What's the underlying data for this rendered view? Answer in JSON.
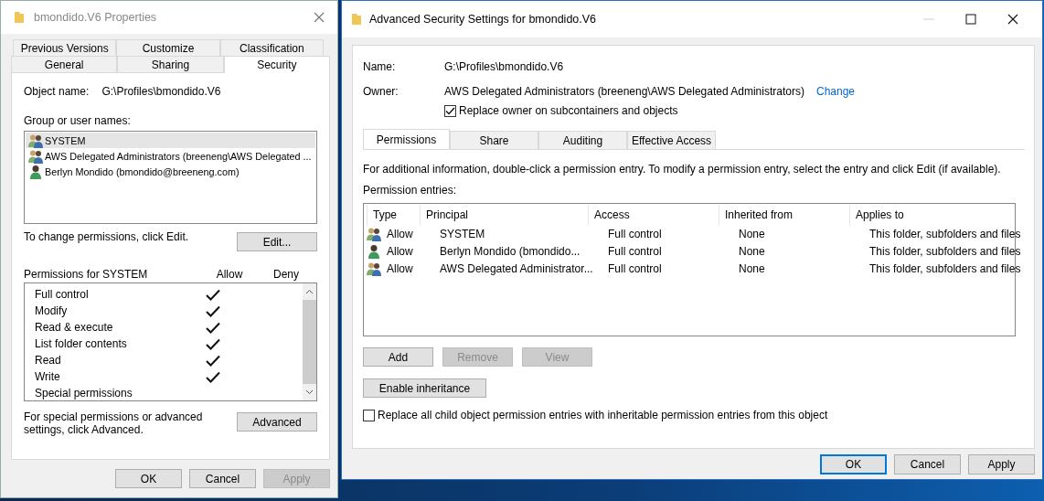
{
  "properties_window": {
    "title": "bmondido.V6 Properties",
    "tab_rows": [
      [
        {
          "label": "Previous Versions",
          "selected": false
        },
        {
          "label": "Customize",
          "selected": false
        },
        {
          "label": "Classification",
          "selected": false
        }
      ],
      [
        {
          "label": "General",
          "selected": false
        },
        {
          "label": "Sharing",
          "selected": false
        },
        {
          "label": "Security",
          "selected": true
        }
      ]
    ],
    "object_name_label": "Object name:",
    "object_name": "G:\\Profiles\\bmondido.V6",
    "groups_label": "Group or user names:",
    "groups": [
      {
        "kind": "group",
        "name": "SYSTEM",
        "selected": true
      },
      {
        "kind": "group",
        "name": "AWS Delegated Administrators (breeneng\\AWS Delegated ...",
        "selected": false
      },
      {
        "kind": "user",
        "name": "Berlyn Mondido (bmondido@breeneng.com)",
        "selected": false
      }
    ],
    "edit_hint": "To change permissions, click Edit.",
    "edit_button": "Edit...",
    "permissions_label": "Permissions for SYSTEM",
    "allow_header": "Allow",
    "deny_header": "Deny",
    "permissions": [
      {
        "name": "Full control",
        "allow": true,
        "deny": false
      },
      {
        "name": "Modify",
        "allow": true,
        "deny": false
      },
      {
        "name": "Read & execute",
        "allow": true,
        "deny": false
      },
      {
        "name": "List folder contents",
        "allow": true,
        "deny": false
      },
      {
        "name": "Read",
        "allow": true,
        "deny": false
      },
      {
        "name": "Write",
        "allow": true,
        "deny": false
      },
      {
        "name": "Special permissions",
        "allow": false,
        "deny": false
      }
    ],
    "advanced_hint": "For special permissions or advanced settings, click Advanced.",
    "advanced_button": "Advanced",
    "buttons": [
      {
        "label": "OK",
        "disabled": false
      },
      {
        "label": "Cancel",
        "disabled": false
      },
      {
        "label": "Apply",
        "disabled": true
      }
    ]
  },
  "advanced_window": {
    "title": "Advanced Security Settings for bmondido.V6",
    "name_label": "Name:",
    "name": "G:\\Profiles\\bmondido.V6",
    "owner_label": "Owner:",
    "owner": "AWS Delegated Administrators (breeneng\\AWS Delegated Administrators)",
    "change_link": "Change",
    "replace_owner": {
      "label": "Replace owner on subcontainers and objects",
      "checked": true
    },
    "tabs": [
      {
        "label": "Permissions",
        "selected": true
      },
      {
        "label": "Share",
        "selected": false
      },
      {
        "label": "Auditing",
        "selected": false
      },
      {
        "label": "Effective Access",
        "selected": false
      }
    ],
    "info": "For additional information, double-click a permission entry. To modify a permission entry, select the entry and click Edit (if available).",
    "entries_label": "Permission entries:",
    "columns": [
      "Type",
      "Principal",
      "Access",
      "Inherited from",
      "Applies to"
    ],
    "rows": [
      {
        "kind": "group",
        "type": "Allow",
        "principal": "SYSTEM",
        "access": "Full control",
        "inherited_from": "None",
        "applies_to": "This folder, subfolders and files"
      },
      {
        "kind": "user",
        "type": "Allow",
        "principal": "Berlyn Mondido (bmondido...",
        "access": "Full control",
        "inherited_from": "None",
        "applies_to": "This folder, subfolders and files"
      },
      {
        "kind": "group",
        "type": "Allow",
        "principal": "AWS Delegated Administrator...",
        "access": "Full control",
        "inherited_from": "None",
        "applies_to": "This folder, subfolders and files"
      }
    ],
    "entry_buttons": [
      {
        "label": "Add",
        "disabled": false
      },
      {
        "label": "Remove",
        "disabled": true
      },
      {
        "label": "View",
        "disabled": true
      }
    ],
    "enable_inheritance_button": "Enable inheritance",
    "replace_child": {
      "label": "Replace all child object permission entries with inheritable permission entries from this object",
      "checked": false
    },
    "buttons": [
      {
        "label": "OK",
        "default": true
      },
      {
        "label": "Cancel",
        "default": false
      },
      {
        "label": "Apply",
        "default": false
      }
    ]
  }
}
